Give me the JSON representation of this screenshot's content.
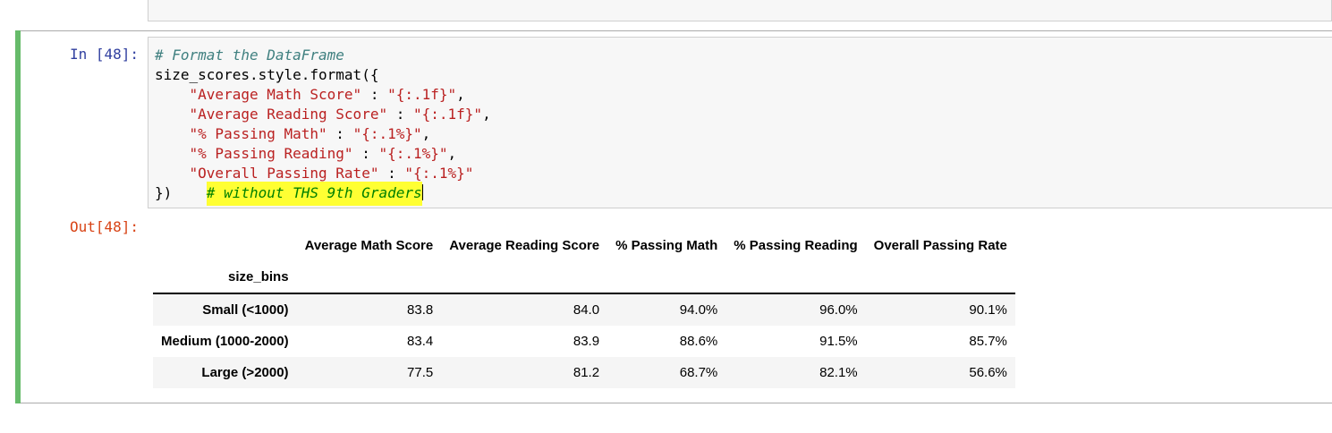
{
  "input_cell": {
    "prompt": "In [48]:",
    "code_lines": [
      {
        "comment": "# Format the DataFrame"
      },
      {
        "text": "size_scores.style.format({"
      },
      {
        "indent": "    ",
        "str": "\"Average Math Score\"",
        "mid": " : ",
        "str2": "\"{:.1f}\"",
        "end": ","
      },
      {
        "indent": "    ",
        "str": "\"Average Reading Score\"",
        "mid": " : ",
        "str2": "\"{:.1f}\"",
        "end": ","
      },
      {
        "indent": "    ",
        "str": "\"% Passing Math\"",
        "mid": " : ",
        "str2": "\"{:.1%}\"",
        "end": ","
      },
      {
        "indent": "    ",
        "str": "\"% Passing Reading\"",
        "mid": " : ",
        "str2": "\"{:.1%}\"",
        "end": ","
      },
      {
        "indent": "    ",
        "str": "\"Overall Passing Rate\"",
        "mid": " : ",
        "str2": "\"{:.1%}\"",
        "end": ""
      },
      {
        "text": "})",
        "highlight_comment": "# without THS 9th Graders"
      }
    ]
  },
  "output_cell": {
    "prompt": "Out[48]:",
    "table": {
      "columns": [
        "Average Math Score",
        "Average Reading Score",
        "% Passing Math",
        "% Passing Reading",
        "Overall Passing Rate"
      ],
      "index_name": "size_bins",
      "rows": [
        {
          "label": "Small (<1000)",
          "values": [
            "83.8",
            "84.0",
            "94.0%",
            "96.0%",
            "90.1%"
          ]
        },
        {
          "label": "Medium (1000-2000)",
          "values": [
            "83.4",
            "83.9",
            "88.6%",
            "91.5%",
            "85.7%"
          ]
        },
        {
          "label": "Large (>2000)",
          "values": [
            "77.5",
            "81.2",
            "68.7%",
            "82.1%",
            "56.6%"
          ]
        }
      ]
    }
  },
  "colors": {
    "cell_selected_bar": "#66bb6a",
    "in_prompt": "#303f9f",
    "out_prompt": "#d84315",
    "highlight": "#ffff33"
  }
}
